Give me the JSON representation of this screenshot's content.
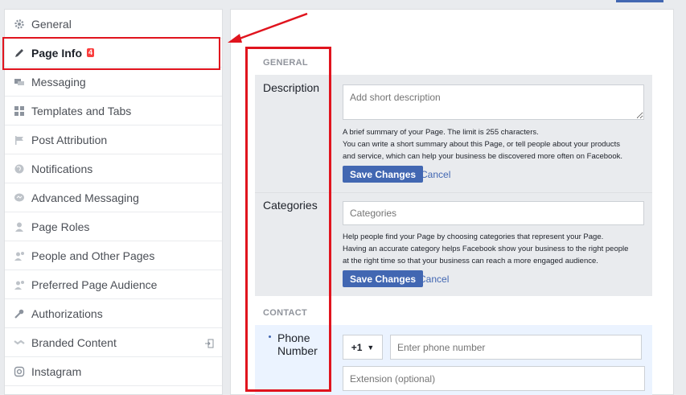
{
  "sidebar": {
    "items": [
      {
        "label": "General",
        "icon": "gear-icon"
      },
      {
        "label": "Page Info",
        "icon": "pencil-icon",
        "badge": "4"
      },
      {
        "label": "Messaging",
        "icon": "chat-bubbles-icon"
      },
      {
        "label": "Templates and Tabs",
        "icon": "grid-icon"
      },
      {
        "label": "Post Attribution",
        "icon": "flag-icon"
      },
      {
        "label": "Notifications",
        "icon": "globe-icon"
      },
      {
        "label": "Advanced Messaging",
        "icon": "messenger-icon"
      },
      {
        "label": "Page Roles",
        "icon": "person-icon"
      },
      {
        "label": "People and Other Pages",
        "icon": "person-gear-icon"
      },
      {
        "label": "Preferred Page Audience",
        "icon": "person-gear-icon"
      },
      {
        "label": "Authorizations",
        "icon": "wrench-icon"
      },
      {
        "label": "Branded Content",
        "icon": "handshake-icon"
      },
      {
        "label": "Instagram",
        "icon": "instagram-icon"
      }
    ]
  },
  "general": {
    "heading": "GENERAL",
    "description": {
      "label": "Description",
      "placeholder": "Add short description",
      "help": [
        "A brief summary of your Page. The limit is 255 characters.",
        "You can write a short summary about this Page, or tell people about your products",
        "and service, which can help your business be discovered more often on Facebook."
      ],
      "save": "Save Changes",
      "cancel": "Cancel"
    },
    "categories": {
      "label": "Categories",
      "placeholder": "Categories",
      "help": [
        "Help people find your Page by choosing categories that represent your Page.",
        "Having an accurate category helps Facebook show your business to the right people",
        "at the right time so that your business can reach a more engaged audience."
      ],
      "save": "Save Changes",
      "cancel": "Cancel"
    }
  },
  "contact": {
    "heading": "CONTACT",
    "phone": {
      "label_line1": "Phone",
      "label_line2": "Number",
      "country_code": "+1",
      "placeholder": "Enter phone number",
      "extension_placeholder": "Extension (optional)"
    }
  },
  "colors": {
    "accent": "#4267b2",
    "annotation": "#e0141e",
    "badge": "#fa3e3e"
  }
}
